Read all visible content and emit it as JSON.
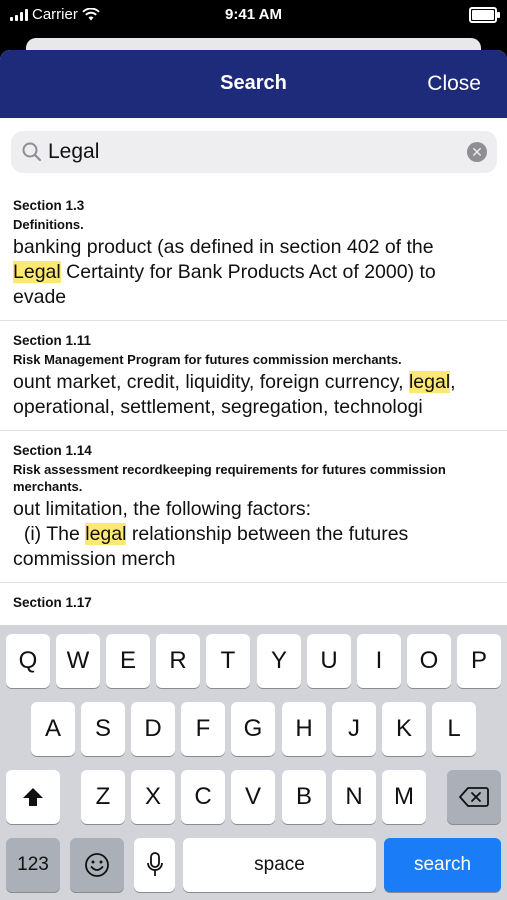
{
  "status": {
    "carrier": "Carrier",
    "time": "9:41 AM"
  },
  "navbar": {
    "title": "Search",
    "close_label": "Close"
  },
  "search": {
    "query": "Legal"
  },
  "results": [
    {
      "section": "Section 1.3",
      "heading": "Definitions.",
      "before": "banking product (as defined in section 402 of the\n",
      "match": "Legal",
      "after": " Certainty for Bank Products Act of 2000) to\nevade"
    },
    {
      "section": "Section 1.11",
      "heading": "Risk Management Program for futures commission merchants.",
      "before": "ount market, credit, liquidity, foreign currency, ",
      "match": "legal",
      "after": ",\noperational, settlement, segregation, technologi"
    },
    {
      "section": "Section 1.14",
      "heading": "Risk assessment recordkeeping requirements for futures commission merchants.",
      "before": "out limitation, the following factors:\n  (i) The ",
      "match": "legal",
      "after": " relationship between the futures\ncommission merch"
    },
    {
      "section": "Section 1.17",
      "heading": "",
      "before": "",
      "match": "",
      "after": ""
    }
  ],
  "keyboard": {
    "row1": [
      "Q",
      "W",
      "E",
      "R",
      "T",
      "Y",
      "U",
      "I",
      "O",
      "P"
    ],
    "row2": [
      "A",
      "S",
      "D",
      "F",
      "G",
      "H",
      "J",
      "K",
      "L"
    ],
    "row3": [
      "Z",
      "X",
      "C",
      "V",
      "B",
      "N",
      "M"
    ],
    "numbers_label": "123",
    "space_label": "space",
    "search_label": "search",
    "icons": {
      "shift": "shift-icon",
      "delete": "delete-icon",
      "emoji": "emoji-icon",
      "mic": "microphone-icon"
    }
  },
  "colors": {
    "navbar": "#1e2a7a",
    "highlight": "#fde872",
    "search_key": "#1a7cf6"
  }
}
